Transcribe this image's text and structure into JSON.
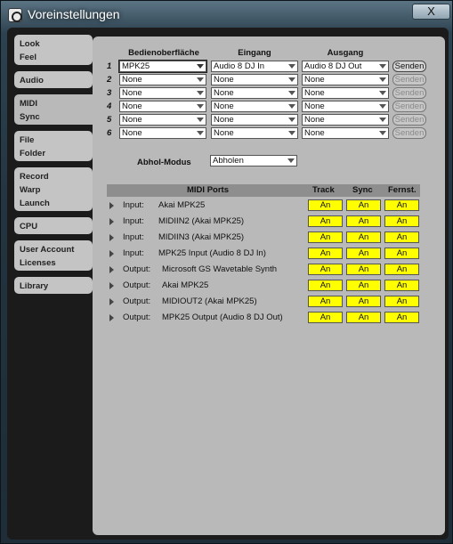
{
  "window": {
    "title": "Voreinstellungen",
    "close_label": "X"
  },
  "sidebar": {
    "tabs": [
      {
        "lines": [
          "Look",
          "Feel"
        ]
      },
      {
        "lines": [
          "Audio"
        ]
      },
      {
        "lines": [
          "MIDI",
          "Sync"
        ]
      },
      {
        "lines": [
          "File",
          "Folder"
        ]
      },
      {
        "lines": [
          "Record",
          "Warp",
          "Launch"
        ]
      },
      {
        "lines": [
          "CPU"
        ]
      },
      {
        "lines": [
          "User Account",
          "Licenses"
        ]
      },
      {
        "lines": [
          "Library"
        ]
      }
    ]
  },
  "control_surfaces": {
    "headers": {
      "surface": "Bedienoberfläche",
      "input": "Eingang",
      "output": "Ausgang"
    },
    "send_label": "Senden",
    "rows": [
      {
        "num": "1",
        "surface": "MPK25",
        "input": "Audio 8 DJ In",
        "output": "Audio 8 DJ Out",
        "send_enabled": true
      },
      {
        "num": "2",
        "surface": "None",
        "input": "None",
        "output": "None",
        "send_enabled": false
      },
      {
        "num": "3",
        "surface": "None",
        "input": "None",
        "output": "None",
        "send_enabled": false
      },
      {
        "num": "4",
        "surface": "None",
        "input": "None",
        "output": "None",
        "send_enabled": false
      },
      {
        "num": "5",
        "surface": "None",
        "input": "None",
        "output": "None",
        "send_enabled": false
      },
      {
        "num": "6",
        "surface": "None",
        "input": "None",
        "output": "None",
        "send_enabled": false
      }
    ]
  },
  "takeover": {
    "label": "Abhol-Modus",
    "value": "Abholen"
  },
  "midi_ports": {
    "headers": {
      "ports": "MIDI Ports",
      "track": "Track",
      "sync": "Sync",
      "remote": "Fernst."
    },
    "rows": [
      {
        "dir": "Input:",
        "name": "Akai MPK25",
        "track": "An",
        "sync": "An",
        "remote": "An"
      },
      {
        "dir": "Input:",
        "name": "MIDIIN2 (Akai MPK25)",
        "track": "An",
        "sync": "An",
        "remote": "An"
      },
      {
        "dir": "Input:",
        "name": "MIDIIN3 (Akai MPK25)",
        "track": "An",
        "sync": "An",
        "remote": "An"
      },
      {
        "dir": "Input:",
        "name": "MPK25 Input (Audio 8 DJ In)",
        "track": "An",
        "sync": "An",
        "remote": "An"
      },
      {
        "dir": "Output:",
        "name": "Microsoft GS Wavetable Synth",
        "track": "An",
        "sync": "An",
        "remote": "An"
      },
      {
        "dir": "Output:",
        "name": "Akai MPK25",
        "track": "An",
        "sync": "An",
        "remote": "An"
      },
      {
        "dir": "Output:",
        "name": "MIDIOUT2 (Akai MPK25)",
        "track": "An",
        "sync": "An",
        "remote": "An"
      },
      {
        "dir": "Output:",
        "name": "MPK25 Output (Audio 8 DJ Out)",
        "track": "An",
        "sync": "An",
        "remote": "An"
      }
    ]
  },
  "colors": {
    "on_button": "#ffff00",
    "panel": "#b9b9b9",
    "frame": "#1b1b1b"
  }
}
